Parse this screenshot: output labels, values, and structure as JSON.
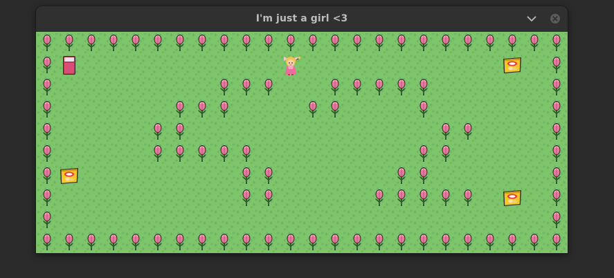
{
  "window": {
    "title": "I'm just a girl <3"
  },
  "titlebar_buttons": [
    {
      "name": "minimize-button",
      "icon": "chevron-down-icon"
    },
    {
      "name": "close-button",
      "icon": "close-icon"
    }
  ],
  "game": {
    "grid_cols": 24,
    "grid_rows": 10,
    "legend": {
      "F": "flower",
      "B": "bed",
      "C": "chips",
      "P": "player",
      ".": "grass"
    },
    "map": [
      "FFFFFFFFFFFFFFFFFFFFFFFF",
      "FB.........P.........C.F",
      "F.......FFF..FFFFF.....F",
      "F.....FFF...FF...F.....F",
      "F....FF...........FF...F",
      "F....FFFFF.......FF....F",
      "FC.......FF.....FF.....F",
      "F........FF....FFFFF.C.F",
      "F......................F",
      "FFFFFFFFFFFFFFFFFFFFFFFF"
    ]
  },
  "colors": {
    "grass": "#7ec46b",
    "flower_petal": "#e8789c",
    "flower_stem": "#2f5a2c",
    "bed_frame": "#b8385a",
    "chips_bag": "#f5c729"
  }
}
